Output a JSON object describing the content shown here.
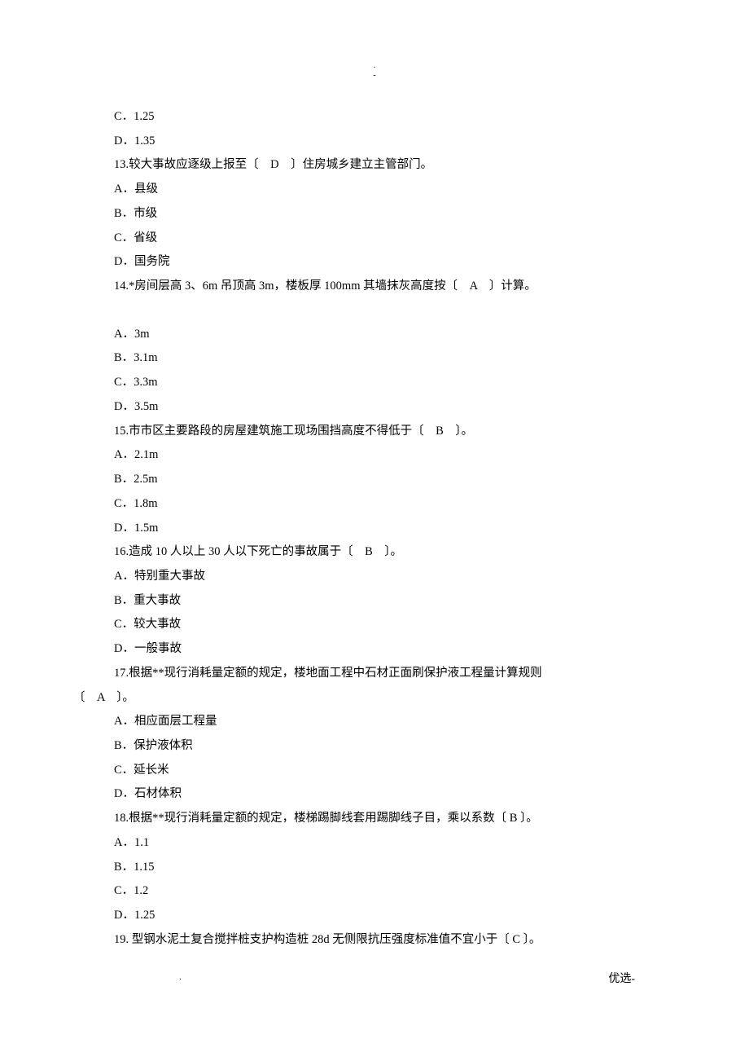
{
  "header": {
    "mark1": ".",
    "mark2": "-"
  },
  "lines": [
    "C．1.25",
    "D．1.35",
    "13.较大事故应逐级上报至〔　D　〕住房城乡建立主管部门。",
    "A．县级",
    "B．市级",
    "C．省级",
    "D．国务院",
    "14.*房间层高 3、6m 吊顶高 3m，楼板厚 100mm 其墙抹灰高度按〔　A　〕计算。"
  ],
  "lines2": [
    "A．3m",
    "B．3.1m",
    "C．3.3m",
    "D．3.5m",
    "15.市市区主要路段的房屋建筑施工现场围挡高度不得低于〔　B　〕。",
    "A．2.1m",
    "B．2.5m",
    "C．1.8m",
    "D．1.5m",
    "16.造成 10 人以上 30 人以下死亡的事故属于〔　B　〕。",
    "A．特别重大事故",
    "B．重大事故",
    "C．较大事故",
    "D．一般事故",
    "17.根据**现行消耗量定额的规定，楼地面工程中石材正面刷保护液工程量计算规则"
  ],
  "noIndentLine": "〔　A　〕。",
  "lines3": [
    "A．相应面层工程量",
    "B．保护液体积",
    "C．延长米",
    "D．石材体积",
    "18.根据**现行消耗量定额的规定，楼梯踢脚线套用踢脚线子目，乘以系数〔 B 〕。",
    "A．1.1",
    "B．1.15",
    "C．1.2",
    "D．1.25",
    "19. 型钢水泥土复合搅拌桩支护构造桩 28d 无侧限抗压强度标准值不宜小于〔 C 〕。"
  ],
  "footer": {
    "left": ".",
    "right": "优选-"
  }
}
